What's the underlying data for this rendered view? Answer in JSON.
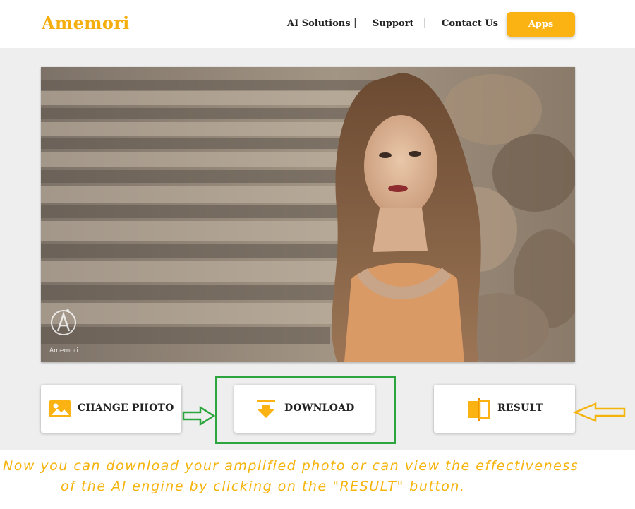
{
  "header": {
    "brand": "Amemori",
    "nav": [
      "AI Solutions",
      "Support",
      "Contact Us"
    ],
    "separator": "|",
    "apps_label": "Apps"
  },
  "photo": {
    "watermark": "Amemori"
  },
  "actions": {
    "change_photo_label": "CHANGE PHOTO",
    "download_label": "DOWNLOAD",
    "result_label": "RESULT"
  },
  "caption": {
    "line1": "Now you can download your amplified photo or can view the effectiveness",
    "line2": "of the AI engine by clicking on the \"RESULT\" button."
  },
  "colors": {
    "accent": "#fbb313",
    "highlight": "#2da53f",
    "annotation": "#f5b40c"
  }
}
